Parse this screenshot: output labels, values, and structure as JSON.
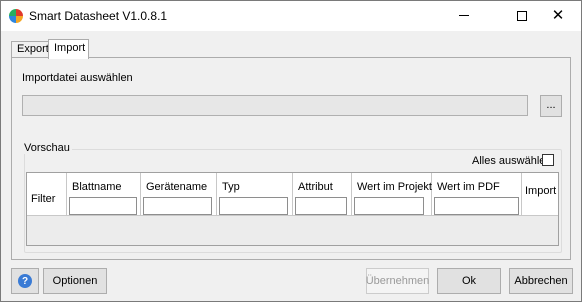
{
  "window": {
    "title": "Smart Datasheet V1.0.8.1",
    "minimize_glyph": "",
    "maximize_glyph": "",
    "close_glyph": "✕"
  },
  "tabs": [
    {
      "label": "Export",
      "selected": false
    },
    {
      "label": "Import",
      "selected": true
    }
  ],
  "import": {
    "file_label": "Importdatei auswählen",
    "file_value": "",
    "browse_label": "..."
  },
  "preview": {
    "group_label": "Vorschau",
    "select_all_label": "Alles auswählen",
    "select_all_checked": false,
    "row_header": "Filter",
    "columns": [
      {
        "title": "Blattname",
        "has_filter": true
      },
      {
        "title": "Gerätename",
        "has_filter": true
      },
      {
        "title": "Typ",
        "has_filter": true
      },
      {
        "title": "Attribut",
        "has_filter": true
      },
      {
        "title": "Wert im Projekt",
        "has_filter": true
      },
      {
        "title": "Wert im PDF",
        "has_filter": true
      },
      {
        "title": "Import",
        "has_filter": false
      }
    ]
  },
  "footer": {
    "help_icon": "question-icon",
    "options_label": "Optionen",
    "apply_label": "Übernehmen",
    "apply_enabled": false,
    "ok_label": "Ok",
    "cancel_label": "Abbrechen"
  }
}
